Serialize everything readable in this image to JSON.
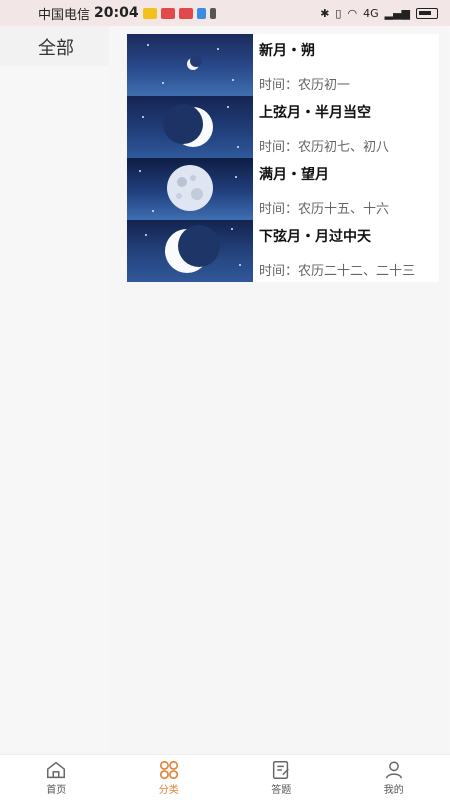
{
  "status_bar": {
    "carrier": "中国电信",
    "time": "20:04",
    "network": "4G"
  },
  "sidebar": {
    "items": [
      {
        "label": "全部"
      }
    ]
  },
  "moons": [
    {
      "title": "新月・朔",
      "time": "时间：农历初一"
    },
    {
      "title": "上弦月・半月当空",
      "time": "时间：农历初七、初八"
    },
    {
      "title": "满月・望月",
      "time": "时间：农历十五、十六"
    },
    {
      "title": "下弦月・月过中天",
      "time": "时间：农历二十二、二十三"
    }
  ],
  "bottom_nav": {
    "items": [
      {
        "label": "首页",
        "icon": "home-icon"
      },
      {
        "label": "分类",
        "icon": "category-icon"
      },
      {
        "label": "答题",
        "icon": "quiz-icon"
      },
      {
        "label": "我的",
        "icon": "profile-icon"
      }
    ],
    "active_color": "#e0853a"
  }
}
